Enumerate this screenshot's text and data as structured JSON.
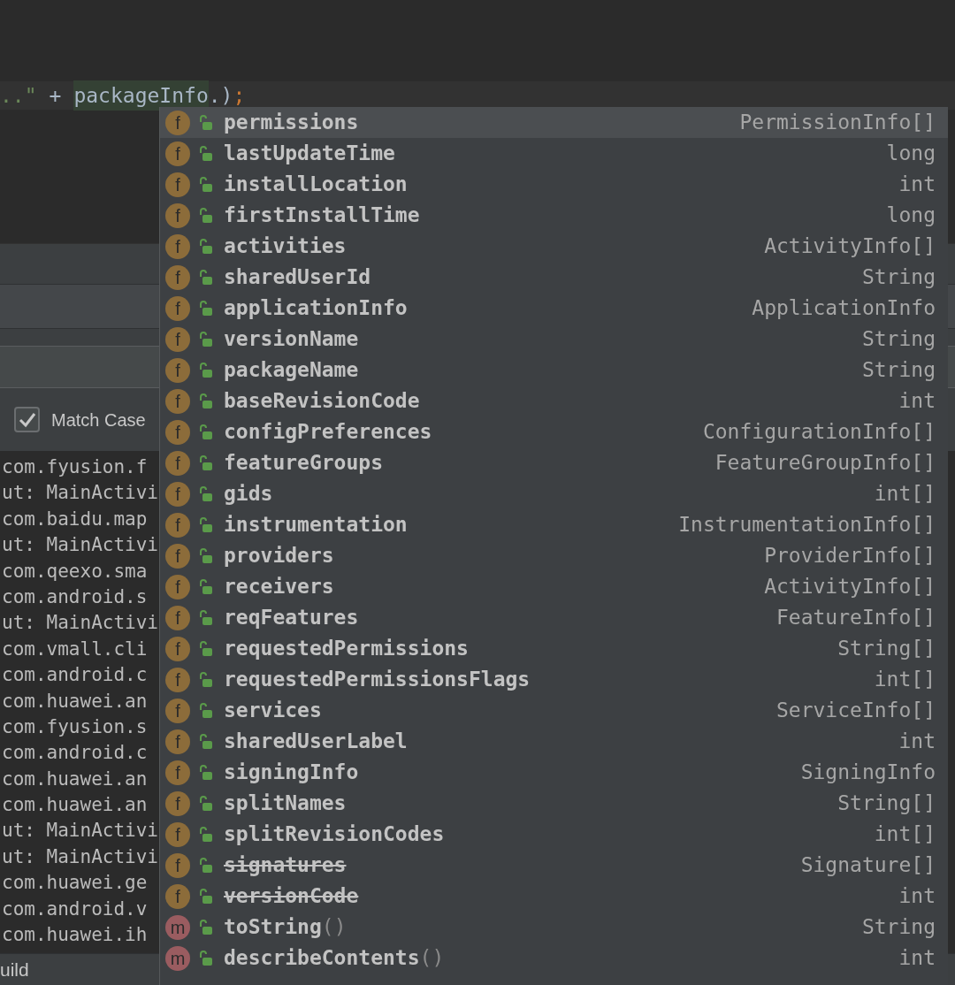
{
  "editor": {
    "code_line": [
      {
        "kind": "string",
        "text": "..\""
      },
      {
        "kind": "operator",
        "text": "+"
      },
      {
        "kind": "highlight",
        "text": "packageInfo"
      },
      {
        "kind": "plain",
        "text": ".)"
      },
      {
        "kind": "keyword",
        "text": ";"
      }
    ]
  },
  "find_panel": {
    "match_case": {
      "label": "Match Case",
      "checked": true
    }
  },
  "log_lines": [
    "com.fyusion.f",
    "ut: MainActivi",
    "com.baidu.map",
    "ut: MainActivi",
    "com.qeexo.sma",
    "com.android.s",
    "ut: MainActivi",
    "com.vmall.cli",
    "com.android.c",
    "com.huawei.an",
    "com.fyusion.s",
    "com.android.c",
    "com.huawei.an",
    "com.huawei.an",
    "ut: MainActivi",
    "ut: MainActivi",
    "com.huawei.ge",
    "com.android.v",
    "com.huawei.ih"
  ],
  "bottom_bar": {
    "tab": "uild"
  },
  "completion_popup": {
    "items": [
      {
        "kind": "field",
        "badge": "f",
        "name": "permissions",
        "type": "PermissionInfo[]",
        "deprecated": false,
        "selected": true
      },
      {
        "kind": "field",
        "badge": "f",
        "name": "lastUpdateTime",
        "type": "long",
        "deprecated": false,
        "selected": false
      },
      {
        "kind": "field",
        "badge": "f",
        "name": "installLocation",
        "type": "int",
        "deprecated": false,
        "selected": false
      },
      {
        "kind": "field",
        "badge": "f",
        "name": "firstInstallTime",
        "type": "long",
        "deprecated": false,
        "selected": false
      },
      {
        "kind": "field",
        "badge": "f",
        "name": "activities",
        "type": "ActivityInfo[]",
        "deprecated": false,
        "selected": false
      },
      {
        "kind": "field",
        "badge": "f",
        "name": "sharedUserId",
        "type": "String",
        "deprecated": false,
        "selected": false
      },
      {
        "kind": "field",
        "badge": "f",
        "name": "applicationInfo",
        "type": "ApplicationInfo",
        "deprecated": false,
        "selected": false
      },
      {
        "kind": "field",
        "badge": "f",
        "name": "versionName",
        "type": "String",
        "deprecated": false,
        "selected": false
      },
      {
        "kind": "field",
        "badge": "f",
        "name": "packageName",
        "type": "String",
        "deprecated": false,
        "selected": false
      },
      {
        "kind": "field",
        "badge": "f",
        "name": "baseRevisionCode",
        "type": "int",
        "deprecated": false,
        "selected": false
      },
      {
        "kind": "field",
        "badge": "f",
        "name": "configPreferences",
        "type": "ConfigurationInfo[]",
        "deprecated": false,
        "selected": false
      },
      {
        "kind": "field",
        "badge": "f",
        "name": "featureGroups",
        "type": "FeatureGroupInfo[]",
        "deprecated": false,
        "selected": false
      },
      {
        "kind": "field",
        "badge": "f",
        "name": "gids",
        "type": "int[]",
        "deprecated": false,
        "selected": false
      },
      {
        "kind": "field",
        "badge": "f",
        "name": "instrumentation",
        "type": "InstrumentationInfo[]",
        "deprecated": false,
        "selected": false
      },
      {
        "kind": "field",
        "badge": "f",
        "name": "providers",
        "type": "ProviderInfo[]",
        "deprecated": false,
        "selected": false
      },
      {
        "kind": "field",
        "badge": "f",
        "name": "receivers",
        "type": "ActivityInfo[]",
        "deprecated": false,
        "selected": false
      },
      {
        "kind": "field",
        "badge": "f",
        "name": "reqFeatures",
        "type": "FeatureInfo[]",
        "deprecated": false,
        "selected": false
      },
      {
        "kind": "field",
        "badge": "f",
        "name": "requestedPermissions",
        "type": "String[]",
        "deprecated": false,
        "selected": false
      },
      {
        "kind": "field",
        "badge": "f",
        "name": "requestedPermissionsFlags",
        "type": "int[]",
        "deprecated": false,
        "selected": false
      },
      {
        "kind": "field",
        "badge": "f",
        "name": "services",
        "type": "ServiceInfo[]",
        "deprecated": false,
        "selected": false
      },
      {
        "kind": "field",
        "badge": "f",
        "name": "sharedUserLabel",
        "type": "int",
        "deprecated": false,
        "selected": false
      },
      {
        "kind": "field",
        "badge": "f",
        "name": "signingInfo",
        "type": "SigningInfo",
        "deprecated": false,
        "selected": false
      },
      {
        "kind": "field",
        "badge": "f",
        "name": "splitNames",
        "type": "String[]",
        "deprecated": false,
        "selected": false
      },
      {
        "kind": "field",
        "badge": "f",
        "name": "splitRevisionCodes",
        "type": "int[]",
        "deprecated": false,
        "selected": false
      },
      {
        "kind": "field",
        "badge": "f",
        "name": "signatures",
        "type": "Signature[]",
        "deprecated": true,
        "selected": false
      },
      {
        "kind": "field",
        "badge": "f",
        "name": "versionCode",
        "type": "int",
        "deprecated": true,
        "selected": false
      },
      {
        "kind": "method",
        "badge": "m",
        "name": "toString",
        "params": "()",
        "type": "String",
        "deprecated": false,
        "selected": false
      },
      {
        "kind": "method",
        "badge": "m",
        "name": "describeContents",
        "params": "()",
        "type": "int",
        "deprecated": false,
        "selected": false
      }
    ]
  }
}
